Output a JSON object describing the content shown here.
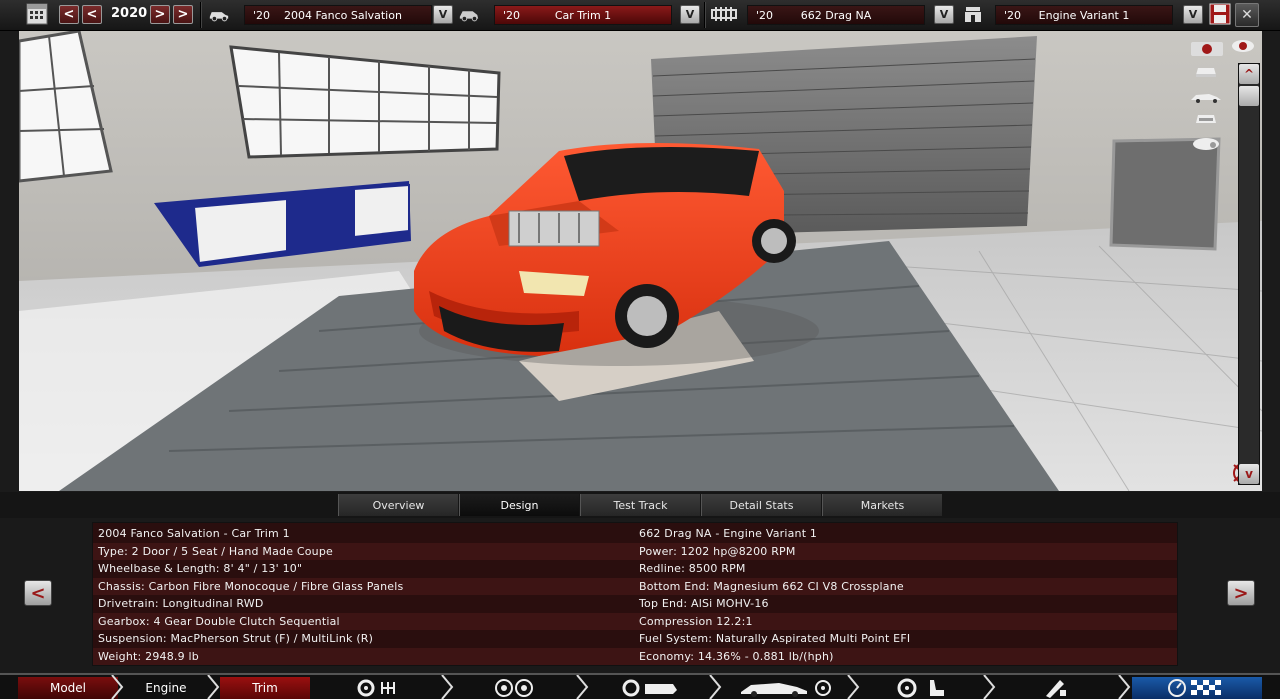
{
  "topbar": {
    "year": "2020",
    "prev_label": "<",
    "prev2_label": "<",
    "next_label": ">",
    "next2_label": ">",
    "model": {
      "year": "'20",
      "name": "2004 Fanco Salvation"
    },
    "trim": {
      "year": "'20",
      "name": "Car Trim 1"
    },
    "engine": {
      "year": "'20",
      "name": "662 Drag NA"
    },
    "engine_variant": {
      "year": "'20",
      "name": "Engine Variant 1"
    },
    "dropdown_label": "V",
    "close_label": "✕"
  },
  "tabs": [
    {
      "label": "Overview"
    },
    {
      "label": "Design",
      "active": true
    },
    {
      "label": "Test Track"
    },
    {
      "label": "Detail Stats"
    },
    {
      "label": "Markets"
    }
  ],
  "info": {
    "left": [
      "2004 Fanco Salvation - Car Trim 1",
      "Type: 2 Door / 5 Seat / Hand Made Coupe",
      "Wheelbase & Length: 8' 4\" / 13' 10\"",
      "Chassis: Carbon Fibre Monocoque / Fibre Glass Panels",
      "Drivetrain: Longitudinal RWD",
      "Gearbox: 4 Gear Double Clutch Sequential",
      "Suspension: MacPherson Strut (F) / MultiLink (R)",
      "Weight: 2948.9 lb"
    ],
    "right": [
      "662 Drag NA - Engine Variant 1",
      "Power: 1202 hp@8200 RPM",
      "Redline: 8500 RPM",
      "Bottom End: Magnesium 662 CI V8 Crossplane",
      "Top End: AlSi MOHV-16",
      "Compression 12.2:1",
      "Fuel System: Naturally Aspirated Multi Point EFI",
      "Economy: 14.36% - 0.881 lb/(hph)"
    ],
    "prev_label": "<",
    "next_label": ">"
  },
  "bottomnav": {
    "model": "Model",
    "engine": "Engine",
    "trim": "Trim"
  },
  "scroll": {
    "up_label": "^",
    "down_label": "v"
  },
  "colors": {
    "accent_red": "#8a1a1a",
    "active_tab": "#0c0c0c"
  }
}
